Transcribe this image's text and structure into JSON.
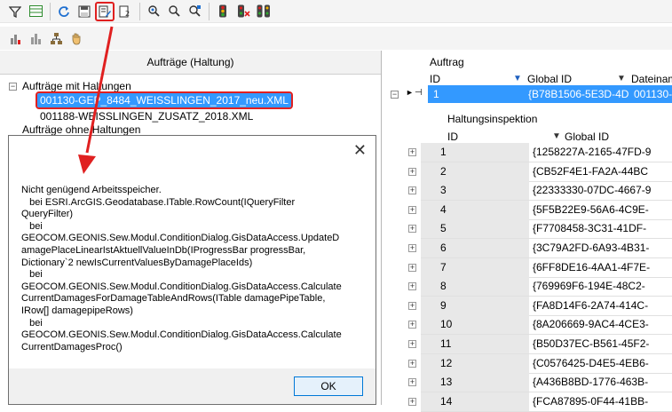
{
  "toolbar1": {
    "icons": [
      "filter-icon",
      "table-icon",
      "refresh-icon",
      "save-icon",
      "edit-list-icon",
      "number-list-icon",
      "zoom-select-icon",
      "zoom-icon",
      "zoom-edit-icon",
      "traffic-light-icon",
      "traffic-light-delete-icon",
      "traffic-light-split-icon"
    ]
  },
  "toolbar2": {
    "icons": [
      "bar-chart-icon",
      "bar-chart-disabled-icon",
      "hierarchy-icon",
      "hand-icon"
    ]
  },
  "left_panel": {
    "title": "Aufträge (Haltung)",
    "tree": {
      "group1": "Aufträge mit Haltungen",
      "item1": "001130-GEP_8484_WEISSLINGEN_2017_neu.XML",
      "item2": "001188-WEISSLINGEN_ZUSATZ_2018.XML",
      "group2": "Aufträge ohne Haltungen"
    }
  },
  "dialog": {
    "close_glyph": "✕",
    "message": "Nicht genügend Arbeitsspeicher.\n   bei ESRI.ArcGIS.Geodatabase.ITable.RowCount(IQueryFilter\nQueryFilter)\n   bei\nGEOCOM.GEONIS.Sew.Modul.ConditionDialog.GisDataAccess.UpdateD\namagePlaceLinearIstAktuellValueInDb(IProgressBar progressBar,\nDictionary`2 newIsCurrentValuesByDamagePlaceIds)\n   bei\nGEOCOM.GEONIS.Sew.Modul.ConditionDialog.GisDataAccess.Calculate\nCurrentDamagesForDamageTableAndRows(ITable damagePipeTable,\nIRow[] damagepipeRows)\n   bei\nGEOCOM.GEONIS.Sew.Modul.ConditionDialog.GisDataAccess.Calculate\nCurrentDamagesProc()",
    "ok_label": "OK"
  },
  "right_grid": {
    "band_title": "Auftrag",
    "col_id": "ID",
    "col_global": "Global ID",
    "col_file": "Dateinam",
    "row": {
      "id": "1",
      "global": "{B78B1506-5E3D-4D",
      "file": "001130-G"
    },
    "sub_title": "Haltungsinspektion",
    "sub_col_id": "ID",
    "sub_col_global": "Global ID",
    "rows": [
      {
        "id": "1",
        "global": "{1258227A-2165-47FD-9"
      },
      {
        "id": "2",
        "global": "{CB52F4E1-FA2A-44BC"
      },
      {
        "id": "3",
        "global": "{22333330-07DC-4667-9"
      },
      {
        "id": "4",
        "global": "{5F5B22E9-56A6-4C9E-"
      },
      {
        "id": "5",
        "global": "{F7708458-3C31-41DF-"
      },
      {
        "id": "6",
        "global": "{3C79A2FD-6A93-4B31-"
      },
      {
        "id": "7",
        "global": "{6FF8DE16-4AA1-4F7E-"
      },
      {
        "id": "8",
        "global": "{769969F6-194E-48C2-"
      },
      {
        "id": "9",
        "global": "{FA8D14F6-2A74-414C-"
      },
      {
        "id": "10",
        "global": "{8A206669-9AC4-4CE3-"
      },
      {
        "id": "11",
        "global": "{B50D37EC-B561-45F2-"
      },
      {
        "id": "12",
        "global": "{C0576425-D4E5-4EB6-"
      },
      {
        "id": "13",
        "global": "{A436B8BD-1776-463B-"
      },
      {
        "id": "14",
        "global": "{FCA87895-0F44-41BB-"
      }
    ]
  },
  "colors": {
    "selection": "#3399ff",
    "highlight": "#e02020"
  }
}
